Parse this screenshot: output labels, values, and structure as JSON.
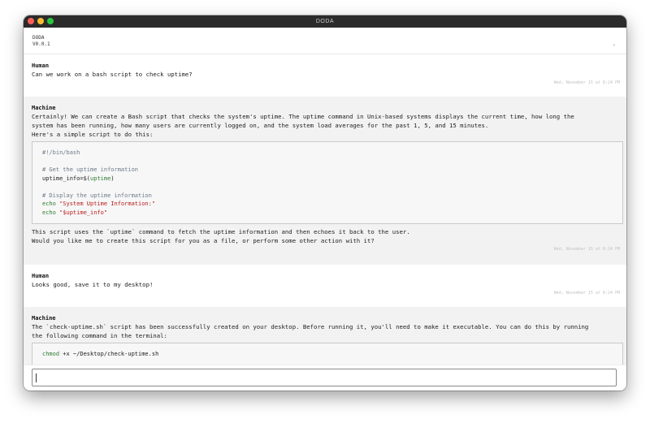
{
  "window": {
    "title": "DODA"
  },
  "header": {
    "app_name": "DODA",
    "version": "V0.0.1",
    "menu_glyph": "."
  },
  "messages": [
    {
      "speaker": "Human",
      "lines": [
        "Can we work on a bash script to check uptime?"
      ],
      "timestamp": "Wed, November 15 at 8:24 PM"
    },
    {
      "speaker": "Machine",
      "lines": [
        "Certainly! We can create a Bash script that checks the system's uptime. The uptime command in Unix-based systems displays the current time, how long the",
        "system has been running, how many users are currently logged on, and the system load averages for the past 1, 5, and 15 minutes.",
        "Here's a simple script to do this:"
      ],
      "code": {
        "shebang": "#!/bin/bash",
        "comment1": "# Get the uptime information",
        "assign_var": "uptime_info=",
        "assign_sub_open": "$(",
        "assign_cmd": "uptime",
        "assign_sub_close": ")",
        "comment2": "# Display the uptime information",
        "echo_kw": "echo",
        "echo1_str": "\"System Uptime Information:\"",
        "echo2_str": "\"$uptime_info\""
      },
      "after_lines": [
        "This script uses the `uptime` command to fetch the uptime information and then echoes it back to the user.",
        "Would you like me to create this script for you as a file, or perform some other action with it?"
      ],
      "timestamp": "Wed, November 15 at 8:24 PM"
    },
    {
      "speaker": "Human",
      "lines": [
        "Looks good, save it to my desktop!"
      ],
      "timestamp": "Wed, November 15 at 8:24 PM"
    },
    {
      "speaker": "Machine",
      "lines": [
        "The `check-uptime.sh` script has been successfully created on your desktop. Before running it, you'll need to make it executable. You can do this by running",
        "the following command in the terminal:"
      ],
      "code": {
        "cmd_kw": "chmod",
        "cmd_args": " +x ~/Desktop/check-uptime.sh"
      }
    }
  ],
  "input": {
    "value": ""
  },
  "colors": {
    "titlebar": "#2b2b2b",
    "machine_bg": "#f2f2f2",
    "code_bg": "#f7f7f7"
  }
}
